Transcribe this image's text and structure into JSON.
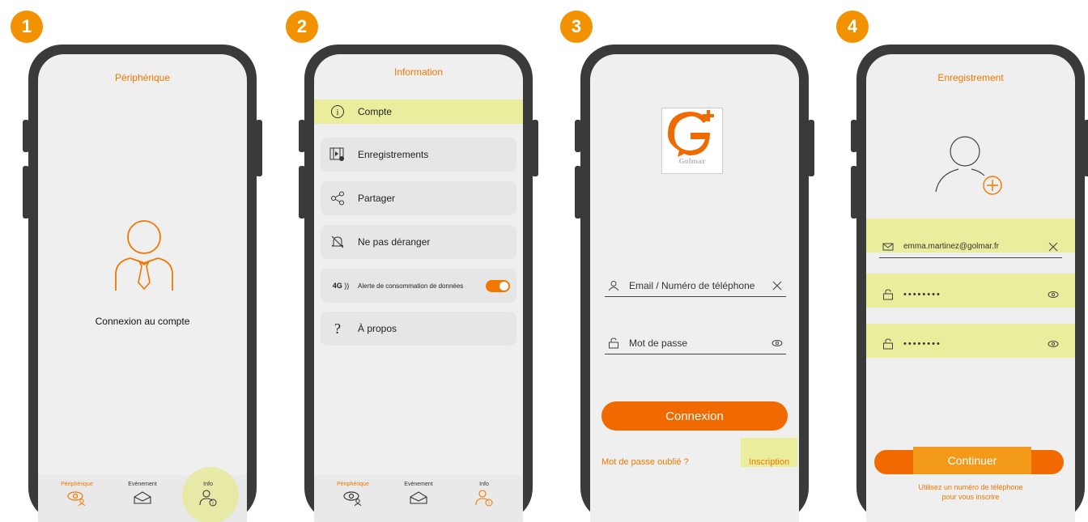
{
  "steps": [
    "1",
    "2",
    "3",
    "4"
  ],
  "screen1": {
    "title": "Périphérique",
    "login_label": "Connexion au compte",
    "nav": [
      {
        "label": "Périphérique",
        "icon": "eye-user-icon"
      },
      {
        "label": "Evènement",
        "icon": "envelope-icon"
      },
      {
        "label": "Info",
        "icon": "user-info-icon"
      }
    ]
  },
  "screen2": {
    "title": "Information",
    "menu": [
      {
        "label": "Compte",
        "icon": "info-circle-icon"
      },
      {
        "label": "Enregistrements",
        "icon": "recordings-icon"
      },
      {
        "label": "Partager",
        "icon": "share-icon"
      },
      {
        "label": "Ne pas déranger",
        "icon": "bell-off-icon"
      },
      {
        "label": "Alerte de consommation de données",
        "prefix": "4G",
        "icon": "4g-signal-icon"
      },
      {
        "label": "À propos",
        "icon": "question-icon"
      }
    ],
    "nav": [
      {
        "label": "Périphérique",
        "icon": "eye-user-icon"
      },
      {
        "label": "Evènement",
        "icon": "envelope-icon"
      },
      {
        "label": "Info",
        "icon": "user-info-icon"
      }
    ]
  },
  "screen3": {
    "logo_text": "Golmar",
    "email_placeholder": "Email / Numéro de téléphone",
    "password_placeholder": "Mot de passe",
    "login_button": "Connexion",
    "forgot_password": "Mot de passe oublié ?",
    "signup": "Inscription"
  },
  "screen4": {
    "title": "Enregistrement",
    "email_value": "emma.martinez@golmar.fr",
    "password_value": "••••••••",
    "password_confirm_value": "••••••••",
    "continue_button": "Continuer",
    "hint_line1": "Utilisez un numéro de téléphone",
    "hint_line2": "pour vous inscrire"
  },
  "colors": {
    "accent": "#f07800",
    "highlight": "#e9ed9c",
    "badge": "#f39200"
  }
}
